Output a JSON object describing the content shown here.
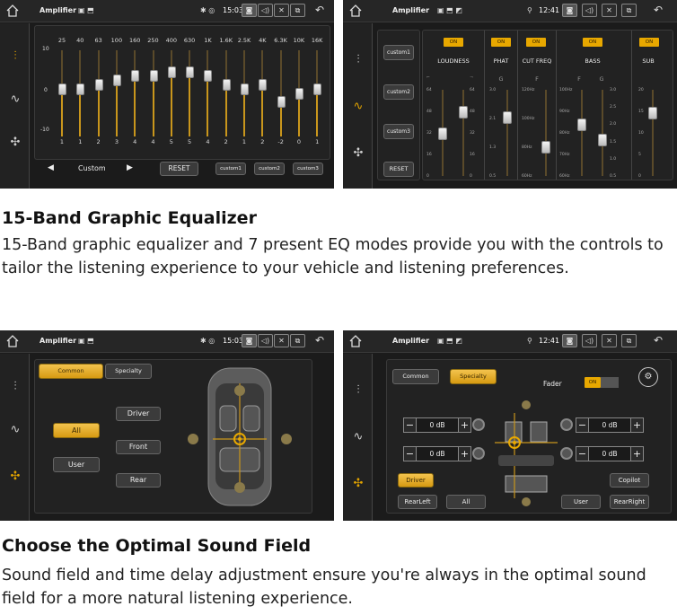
{
  "status": {
    "title": "Amplifier",
    "time1": "15:03",
    "time2": "12:41",
    "back": "↶",
    "cam": "◙",
    "vol": "◁)",
    "x": "✕",
    "dual": "⧉"
  },
  "geq": {
    "freqs": [
      "25",
      "40",
      "63",
      "100",
      "160",
      "250",
      "400",
      "630",
      "1K",
      "1.6K",
      "2.5K",
      "4K",
      "6.3K",
      "10K",
      "16K"
    ],
    "values": [
      "1",
      "1",
      "2",
      "3",
      "4",
      "4",
      "5",
      "5",
      "4",
      "2",
      "1",
      "2",
      "-2",
      "0",
      "1"
    ],
    "levels": [
      1,
      1,
      2,
      3,
      4,
      4,
      5,
      5,
      4,
      2,
      1,
      2,
      -2,
      0,
      1
    ],
    "ylabels": [
      "10",
      "0",
      "-10"
    ],
    "preset": "Custom",
    "prev": "◀",
    "next": "▶",
    "reset": "RESET",
    "customs": [
      "custom1",
      "custom2",
      "custom3"
    ]
  },
  "peq": {
    "customs": [
      "custom1",
      "custom2",
      "custom3"
    ],
    "reset": "RESET",
    "on": "ON",
    "cols": [
      {
        "name": "LOUDNESS"
      },
      {
        "name": "PHAT"
      },
      {
        "name": "CUT FREQ"
      },
      {
        "name": "BASS"
      },
      {
        "name": "SUB"
      }
    ],
    "loud_ticks": [
      "64",
      "48",
      "32",
      "16",
      "0"
    ],
    "phat_ticks": [
      "3.0",
      "2.1",
      "1.3",
      "0.5"
    ],
    "cut_ticks": [
      "120Hz",
      "100Hz",
      "80Hz",
      "60Hz"
    ],
    "bassf_ticks": [
      "100Hz",
      "90Hz",
      "80Hz",
      "70Hz",
      "60Hz"
    ],
    "bassg_ticks": [
      "3.0",
      "2.5",
      "2.0",
      "1.5",
      "1.0",
      "0.5"
    ],
    "sub_ticks": [
      "20",
      "15",
      "10",
      "5",
      "0"
    ],
    "g": "G",
    "f": "F"
  },
  "sf1": {
    "tabs": [
      "Common",
      "Specialty"
    ],
    "buttons": [
      "Driver",
      "Front",
      "Rear",
      "All",
      "User"
    ]
  },
  "sf2": {
    "tabs": [
      "Common",
      "Specialty"
    ],
    "fader": "Fader",
    "on": "ON",
    "db": [
      "0 dB",
      "0 dB",
      "0 dB",
      "0 dB"
    ],
    "minus": "−",
    "plus": "+",
    "buttons": [
      "Driver",
      "Copilot",
      "RearLeft",
      "All",
      "User",
      "RearRight"
    ]
  },
  "text": {
    "h1": "15-Band Graphic Equalizer",
    "d1": "15-Band graphic equalizer and 7 present EQ modes provide you with the controls to tailor the listening experience to your vehicle and listening preferences.",
    "h2": "Choose the Optimal Sound Field",
    "d2": "Sound field and time delay adjustment ensure you're always in the optimal sound field for a more natural listening experience."
  }
}
